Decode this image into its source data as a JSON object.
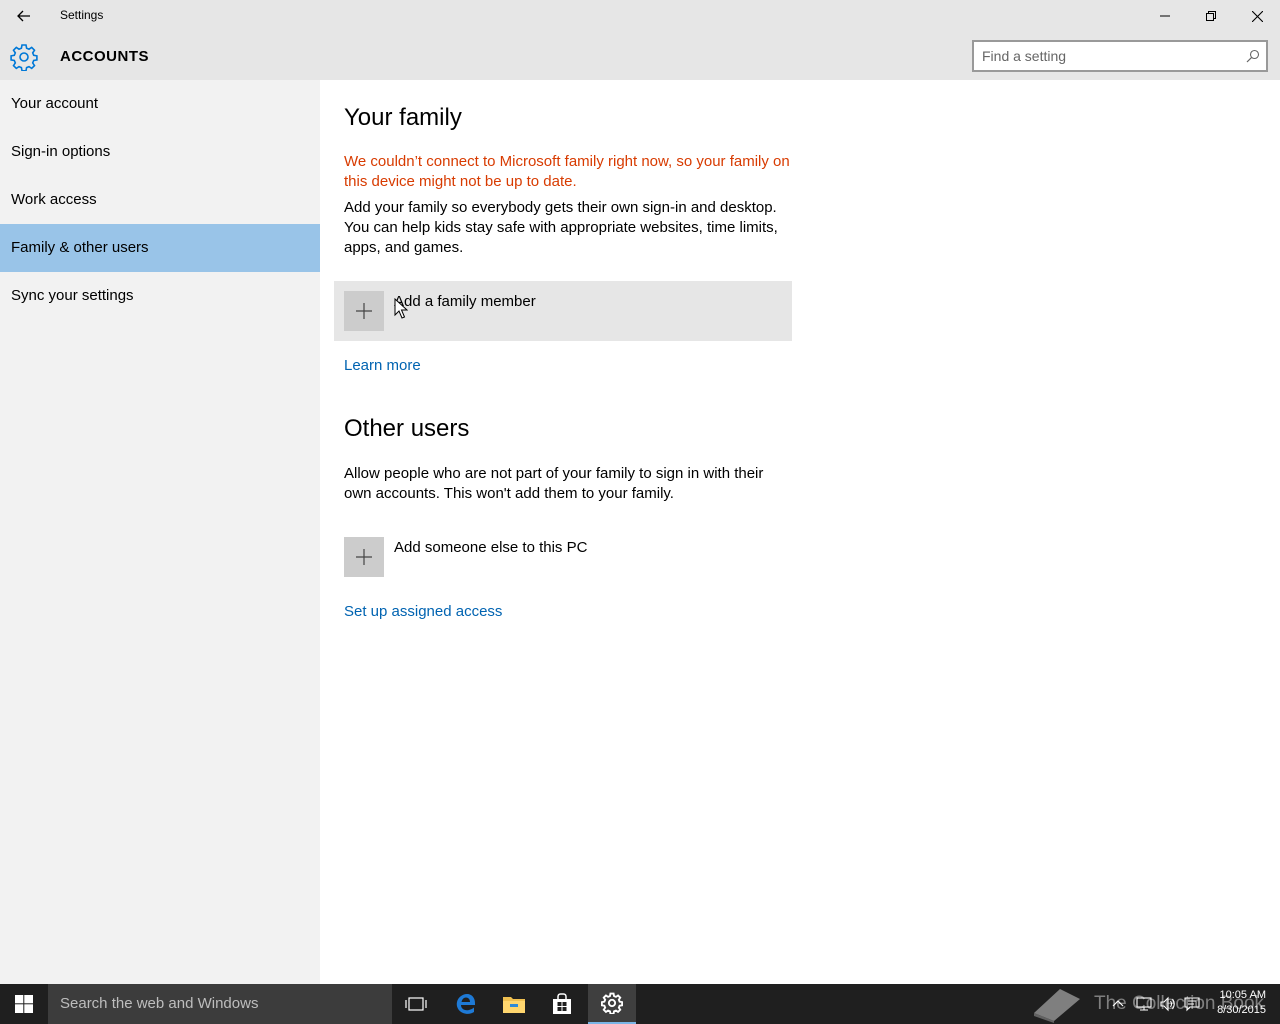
{
  "window": {
    "title": "Settings"
  },
  "header": {
    "title": "ACCOUNTS",
    "search_placeholder": "Find a setting"
  },
  "sidebar": {
    "items": [
      {
        "label": "Your account",
        "selected": false
      },
      {
        "label": "Sign-in options",
        "selected": false
      },
      {
        "label": "Work access",
        "selected": false
      },
      {
        "label": "Family & other users",
        "selected": true
      },
      {
        "label": "Sync your settings",
        "selected": false
      }
    ]
  },
  "main": {
    "family": {
      "heading": "Your family",
      "warning": "We couldn’t connect to Microsoft family right now, so your family on this device might not be up to date.",
      "description": "Add your family so everybody gets their own sign-in and desktop. You can help kids stay safe with appropriate websites, time limits, apps, and games.",
      "add_label": "Add a family member",
      "learn_more": "Learn more"
    },
    "other_users": {
      "heading": "Other users",
      "description": "Allow people who are not part of your family to sign in with their own accounts. This won't add them to your family.",
      "add_label": "Add someone else to this PC",
      "assigned_access": "Set up assigned access"
    }
  },
  "taskbar": {
    "search_placeholder": "Search the web and Windows",
    "time": "10:05 AM",
    "date": "8/30/2015",
    "watermark": "The Collection Book"
  },
  "colors": {
    "accent": "#0063b1",
    "selected_nav": "#99c4e8",
    "warning": "#d83b01"
  }
}
